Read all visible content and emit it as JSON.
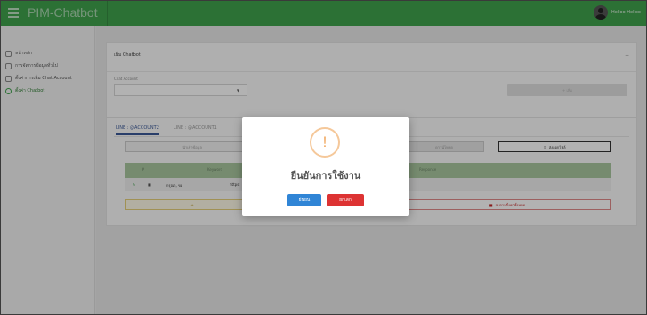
{
  "header": {
    "app_title": "PIM-Chatbot",
    "user_name": "Helloo Helloo"
  },
  "sidebar": {
    "items": [
      {
        "label": "หน้าหลัก",
        "active": false
      },
      {
        "label": "การจัดการข้อมูลทั่วไป",
        "active": false
      },
      {
        "label": "ตั้งค่าการเพิ่ม Chat Account",
        "active": false
      },
      {
        "label": "ตั้งค่า Chatbot",
        "active": true
      }
    ]
  },
  "card1": {
    "title": "เพิ่ม Chatbot",
    "collapse_icon": "minus-icon",
    "field_label": "Chat Account",
    "select_value": "",
    "add_button": "+ เพิ่ม"
  },
  "card2": {
    "tabs": [
      "LINE : @ACCOUNT2",
      "LINE : @ACCOUNT1"
    ],
    "left_button": "นำเข้าข้อมูล",
    "mid_button": "ดาวน์โหลด",
    "right_button": "ส่งออกไฟล์",
    "columns": [
      "#",
      "Keyword",
      "Response"
    ],
    "rows": [
      {
        "keyword": "กรุณา, ขอ",
        "response": "https:"
      }
    ],
    "yellow_bar": "+",
    "red_bar": "ลบการตั้งค่าทั้งหมด"
  },
  "modal": {
    "icon": "!",
    "title": "ยืนยันการใช้งาน",
    "confirm": "ยืนยัน",
    "cancel": "ยกเลิก"
  },
  "colors": {
    "primary": "#3fa34d",
    "confirm": "#3085d6",
    "cancel": "#dd3333",
    "warning": "#f0a860"
  }
}
